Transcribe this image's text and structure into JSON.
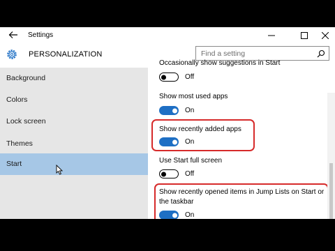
{
  "window": {
    "title": "Settings"
  },
  "header": {
    "page_title": "PERSONALIZATION",
    "search_placeholder": "Find a setting"
  },
  "sidebar": {
    "items": [
      {
        "label": "Background",
        "selected": false
      },
      {
        "label": "Colors",
        "selected": false
      },
      {
        "label": "Lock screen",
        "selected": false
      },
      {
        "label": "Themes",
        "selected": false
      },
      {
        "label": "Start",
        "selected": true
      }
    ]
  },
  "settings": [
    {
      "label": "Occasionally show suggestions in Start",
      "state": "Off",
      "on": false
    },
    {
      "label": "Show most used apps",
      "state": "On",
      "on": true
    },
    {
      "label": "Show recently added apps",
      "state": "On",
      "on": true,
      "highlighted": true
    },
    {
      "label": "Use Start full screen",
      "state": "Off",
      "on": false
    },
    {
      "label_line1": "Show recently opened items in Jump Lists on Start or",
      "label_line2": "the taskbar",
      "state": "On",
      "on": true,
      "highlighted": true
    }
  ],
  "colors": {
    "accent": "#1e6fc4",
    "selected_bg": "#a6c7e6",
    "highlight": "#d62a2a"
  },
  "icons": [
    "back-arrow-icon",
    "minimize-icon",
    "maximize-icon",
    "close-icon",
    "gear-icon",
    "search-icon",
    "mouse-cursor-icon"
  ]
}
